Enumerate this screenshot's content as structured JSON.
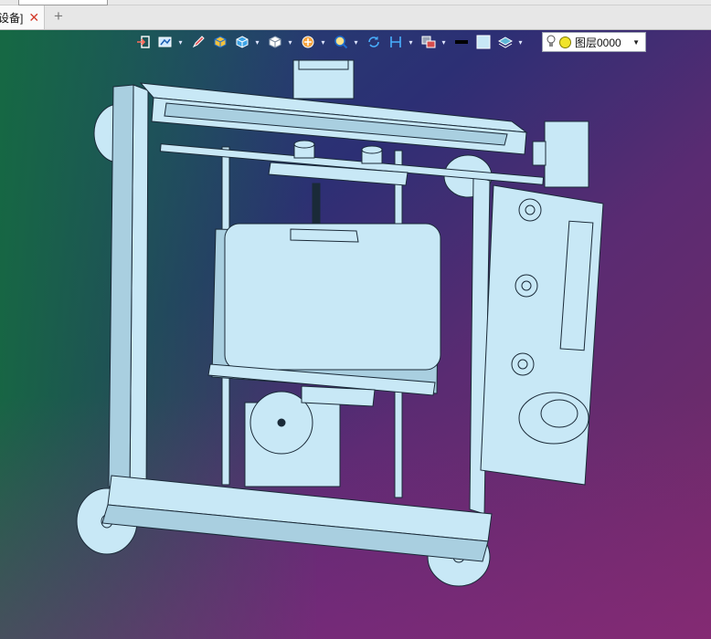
{
  "tab": {
    "label": "设备]",
    "close_icon": "close-icon",
    "new_tab_icon": "plus-icon"
  },
  "toolbar": {
    "buttons": [
      {
        "name": "exit-button",
        "icon": "exit-icon",
        "dropdown": false
      },
      {
        "name": "render-mode-button",
        "icon": "render-mode-icon",
        "dropdown": true
      },
      {
        "name": "sketch-pen-button",
        "icon": "pencil-icon",
        "dropdown": false
      },
      {
        "name": "box-yellow-button",
        "icon": "solid-box-icon",
        "dropdown": false
      },
      {
        "name": "box-blue-button",
        "icon": "shaded-box-icon",
        "dropdown": true
      },
      {
        "name": "view-cube-button",
        "icon": "view-cube-icon",
        "dropdown": true
      },
      {
        "name": "orbit-button",
        "icon": "orbit-icon",
        "dropdown": true
      },
      {
        "name": "zoom-button",
        "icon": "zoom-icon",
        "dropdown": true
      },
      {
        "name": "rotate-button",
        "icon": "rotate-icon",
        "dropdown": false
      },
      {
        "name": "dimension-button",
        "icon": "dimension-icon",
        "dropdown": true
      },
      {
        "name": "display-button",
        "icon": "display-icon",
        "dropdown": true
      },
      {
        "name": "line-color-button",
        "icon": "black-swatch-icon",
        "dropdown": false
      },
      {
        "name": "fill-color-button",
        "icon": "light-swatch-icon",
        "dropdown": false
      },
      {
        "name": "layer-style-button",
        "icon": "layers-icon",
        "dropdown": true
      }
    ]
  },
  "layer": {
    "name": "图层0000",
    "bulb_icon": "lightbulb-icon",
    "status_icon": "yellow-dot-icon",
    "dropdown_icon": "caret-down-icon"
  },
  "colors": {
    "part_fill": "#c8e8f6",
    "part_edge": "#1a2a38",
    "part_shadow": "#a9cfe0"
  }
}
